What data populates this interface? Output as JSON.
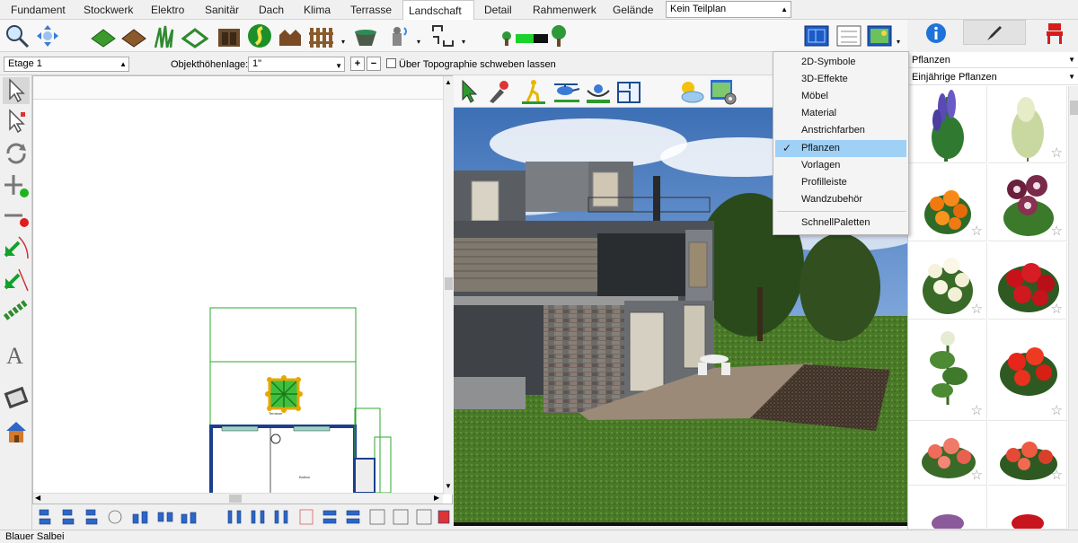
{
  "menu_tabs": [
    "Fundament",
    "Stockwerk",
    "Elektro",
    "Sanitär",
    "Dach",
    "Klima",
    "Terrasse",
    "Landschaft",
    "Detail",
    "Rahmenwerk",
    "Gelände"
  ],
  "active_tab": "Landschaft",
  "teilplan": {
    "value": "Kein Teilplan"
  },
  "toolbar2": {
    "etage_value": "Etage 1",
    "objekthoehe_label": "Objekthöhenlage:",
    "objekthoehe_value": "1\"",
    "plus_label": "+",
    "minus_label": "−",
    "topographie_label": "Über Topographie schweben lassen"
  },
  "plan": {
    "room_label": "Balkon",
    "terrace_label": "Terrasse"
  },
  "dropdown": {
    "items": [
      "2D-Symbole",
      "3D-Effekte",
      "Möbel",
      "Material",
      "Anstrichfarben",
      "Pflanzen",
      "Vorlagen",
      "Profilleiste",
      "Wandzubehör",
      "SchnellPaletten"
    ],
    "checked": "Pflanzen",
    "check_mark": "✓"
  },
  "rightpanel": {
    "category": "Pflanzen",
    "subcategory": "Einjährige Pflanzen",
    "star": "☆"
  },
  "status": {
    "text": "Blauer Salbei"
  },
  "colors": {
    "accent": "#9fd0f5",
    "green": "#2e8b2e",
    "grass": "#4f7f2c"
  }
}
